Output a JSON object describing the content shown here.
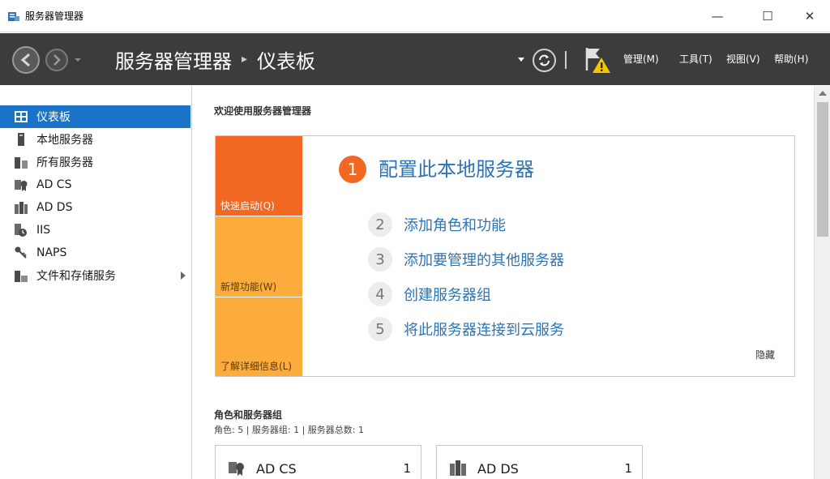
{
  "window": {
    "title": "服务器管理器",
    "min_glyph": "—",
    "max_glyph": "☐",
    "close_glyph": "✕"
  },
  "header": {
    "app_name": "服务器管理器",
    "separator": "▸",
    "page": "仪表板",
    "menus": [
      "管理(M)",
      "工具(T)",
      "视图(V)",
      "帮助(H)"
    ]
  },
  "sidebar": {
    "items": [
      {
        "label": "仪表板",
        "icon": "dashboard-icon",
        "active": true
      },
      {
        "label": "本地服务器",
        "icon": "local-server-icon"
      },
      {
        "label": "所有服务器",
        "icon": "all-servers-icon"
      },
      {
        "label": "AD CS",
        "icon": "adcs-icon"
      },
      {
        "label": "AD DS",
        "icon": "adds-icon"
      },
      {
        "label": "IIS",
        "icon": "iis-icon"
      },
      {
        "label": "NAPS",
        "icon": "naps-icon"
      },
      {
        "label": "文件和存储服务",
        "icon": "file-storage-icon",
        "has_arrow": true
      }
    ]
  },
  "welcome": {
    "title": "欢迎使用服务器管理器",
    "tiles": [
      "快速启动(Q)",
      "新增功能(W)",
      "了解详细信息(L)"
    ],
    "steps": [
      {
        "num": "1",
        "label": "配置此本地服务器"
      },
      {
        "num": "2",
        "label": "添加角色和功能"
      },
      {
        "num": "3",
        "label": "添加要管理的其他服务器"
      },
      {
        "num": "4",
        "label": "创建服务器组"
      },
      {
        "num": "5",
        "label": "将此服务器连接到云服务"
      }
    ],
    "hide": "隐藏"
  },
  "roles": {
    "title": "角色和服务器组",
    "summary": "角色: 5 | 服务器组: 1 | 服务器总数: 1",
    "cards": [
      {
        "name": "AD CS",
        "count": "1",
        "icon": "adcs-icon"
      },
      {
        "name": "AD DS",
        "count": "1",
        "icon": "adds-icon"
      }
    ]
  },
  "colors": {
    "accent": "#1a73c6",
    "orange": "#f26822",
    "amber": "#fbac3c",
    "link": "#2d74b5",
    "header_bg": "#3c3c3c"
  }
}
